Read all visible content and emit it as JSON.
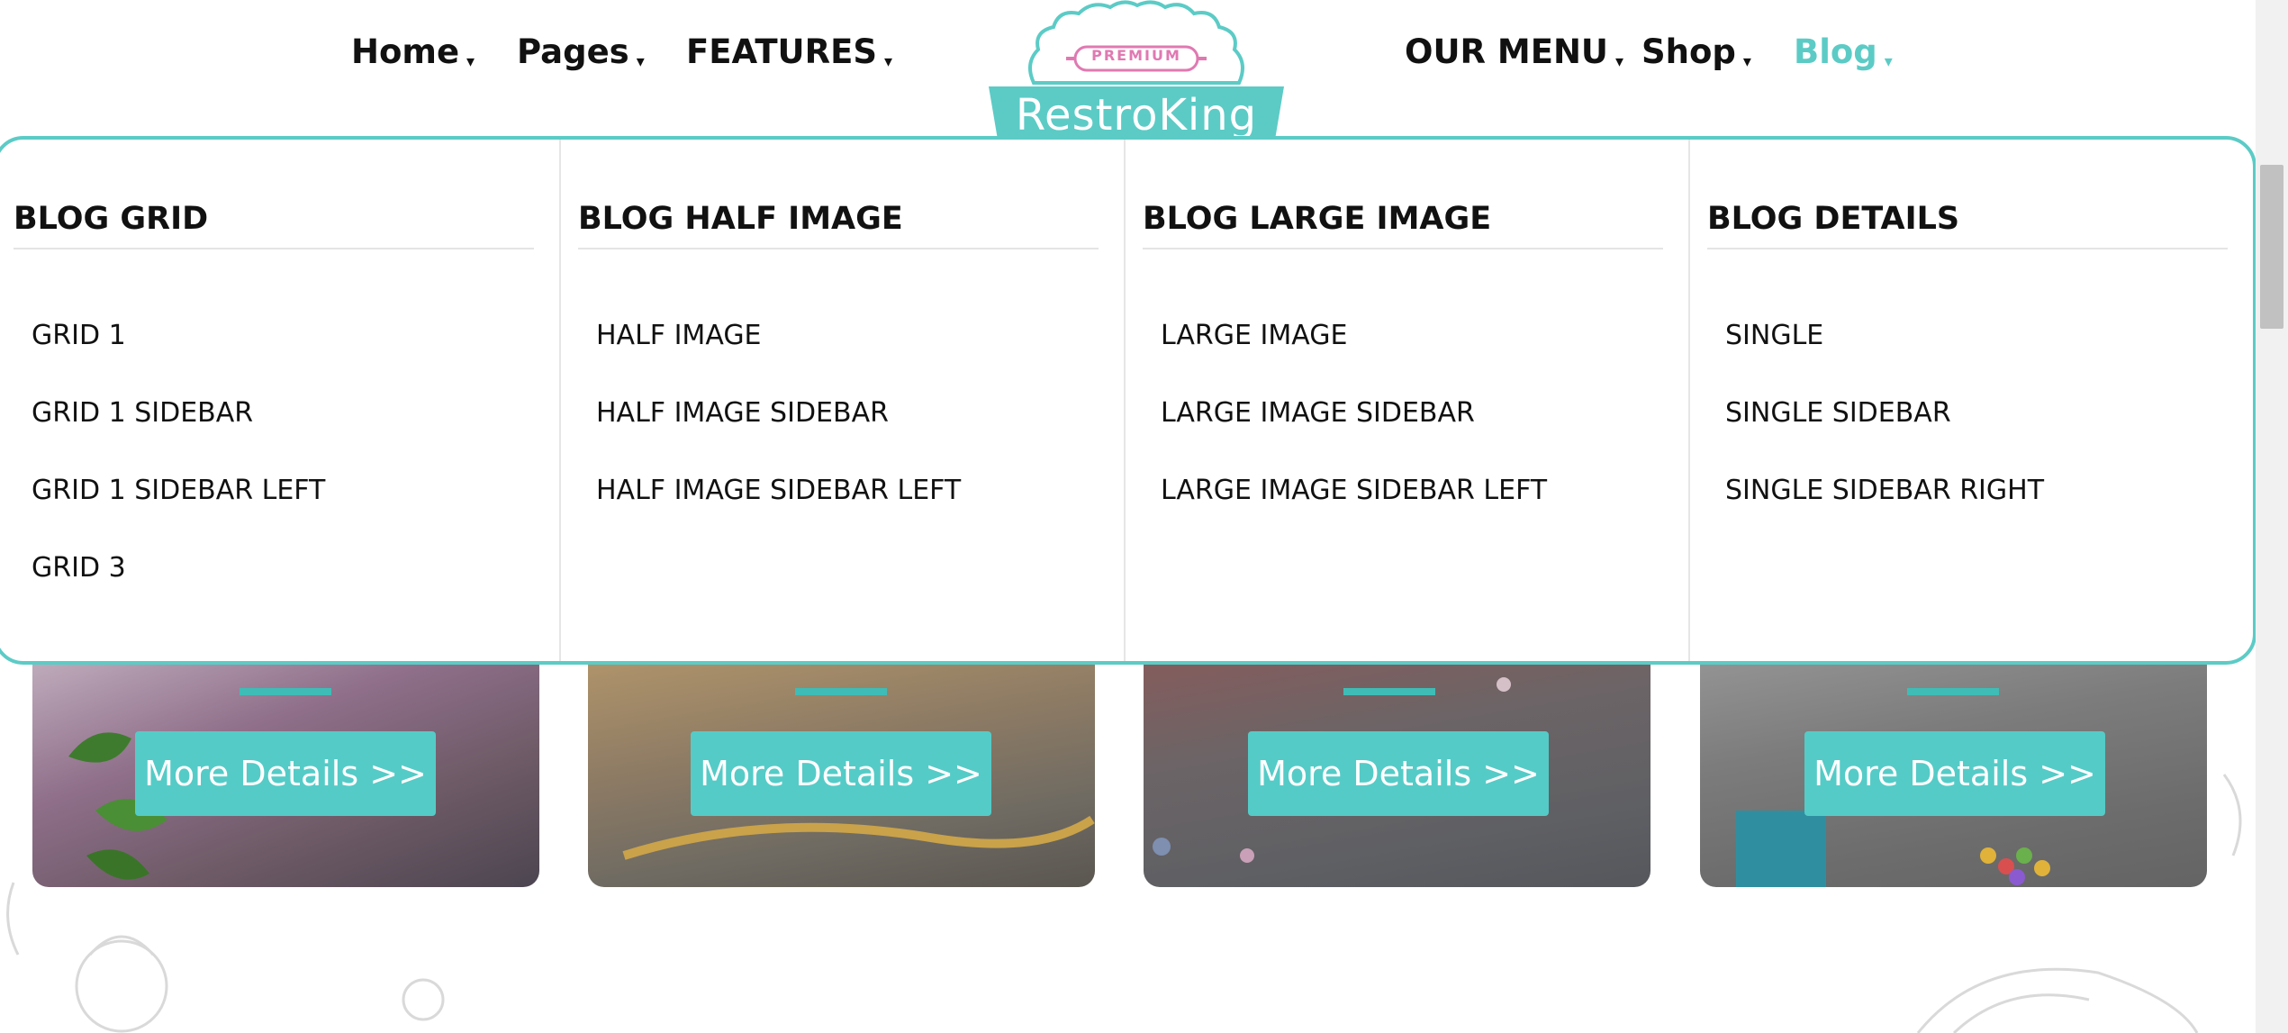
{
  "nav": {
    "left_items": [
      {
        "label": "Home",
        "caret": "▾"
      },
      {
        "label": "Pages",
        "caret": "▾"
      },
      {
        "label": "FEATURES",
        "caret": "▾"
      }
    ],
    "right_items": [
      {
        "label": "OUR MENU",
        "caret": "▾"
      },
      {
        "label": "Shop",
        "caret": "▾"
      },
      {
        "label": "Blog",
        "caret": "▾",
        "active": true
      }
    ]
  },
  "logo": {
    "word": "RestroKing",
    "badge": "PREMIUM",
    "icon": "cake-logo"
  },
  "mega_menu": {
    "columns": [
      {
        "heading": "BLOG GRID",
        "items": [
          "GRID 1",
          "GRID 1 SIDEBAR",
          "GRID 1 SIDEBAR LEFT",
          "GRID 3"
        ]
      },
      {
        "heading": "BLOG HALF IMAGE",
        "items": [
          "HALF IMAGE",
          "HALF IMAGE SIDEBAR",
          "HALF IMAGE SIDEBAR LEFT"
        ]
      },
      {
        "heading": "BLOG LARGE IMAGE",
        "items": [
          "LARGE IMAGE",
          "LARGE IMAGE SIDEBAR",
          "LARGE IMAGE SIDEBAR LEFT"
        ]
      },
      {
        "heading": "BLOG DETAILS",
        "items": [
          "SINGLE",
          "SINGLE SIDEBAR",
          "SINGLE SIDEBAR RIGHT"
        ]
      }
    ]
  },
  "cards": [
    {
      "button": "More Details >>"
    },
    {
      "button": "More Details >>"
    },
    {
      "button": "More Details >>"
    },
    {
      "button": "More Details >>"
    }
  ],
  "colors": {
    "accent": "#5ccbc6",
    "button": "#55cbc7",
    "pink": "#e079b2"
  }
}
